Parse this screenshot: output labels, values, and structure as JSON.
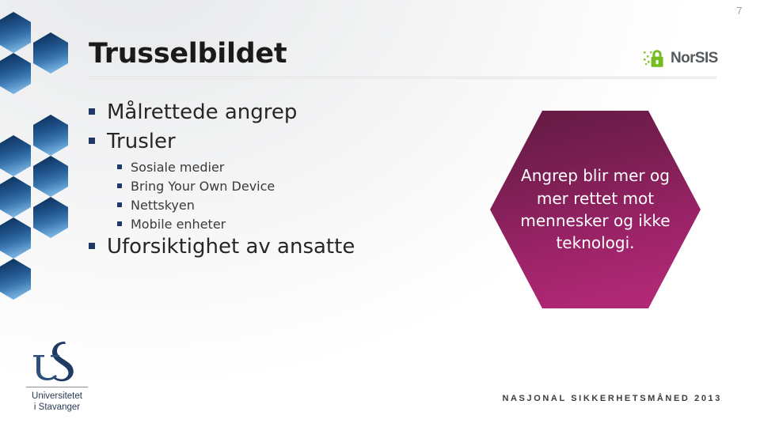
{
  "slide": {
    "page_number": "7",
    "title": "Trusselbildet",
    "background_color": "#f2f3f4"
  },
  "norsis_logo": {
    "icon": "padlock-icon",
    "wordmark": "NorSIS",
    "lock_color": "#76bc21",
    "text_color": "#555b5e"
  },
  "bullets": [
    {
      "level": 1,
      "text": "Målrettede angrep"
    },
    {
      "level": 1,
      "text": "Trusler"
    },
    {
      "level": 2,
      "text": "Sosiale medier"
    },
    {
      "level": 2,
      "text": "Bring Your Own Device"
    },
    {
      "level": 2,
      "text": "Nettskyen"
    },
    {
      "level": 2,
      "text": "Mobile enheter"
    },
    {
      "level": 1,
      "text": "Uforsiktighet av ansatte"
    }
  ],
  "bullet_marker_color": "#1f3864",
  "callout": {
    "shape": "hexagon",
    "text": "Angrep blir mer og mer rettet mot mennesker og ikke teknologi.",
    "gradient_top": "#6b1f49",
    "gradient_bottom": "#ad2572",
    "text_color": "#ffffff"
  },
  "honeycomb": {
    "shape": "hexagon-pattern",
    "gradient_top": "#12355f",
    "gradient_bottom": "#6ea8d8"
  },
  "uis_logo": {
    "monogram": "US",
    "line1": "Universitetet",
    "line2": "i Stavanger",
    "color": "#1f3a63"
  },
  "footer": {
    "text": "NASJONAL SIKKERHETSMÅNED 2013"
  }
}
